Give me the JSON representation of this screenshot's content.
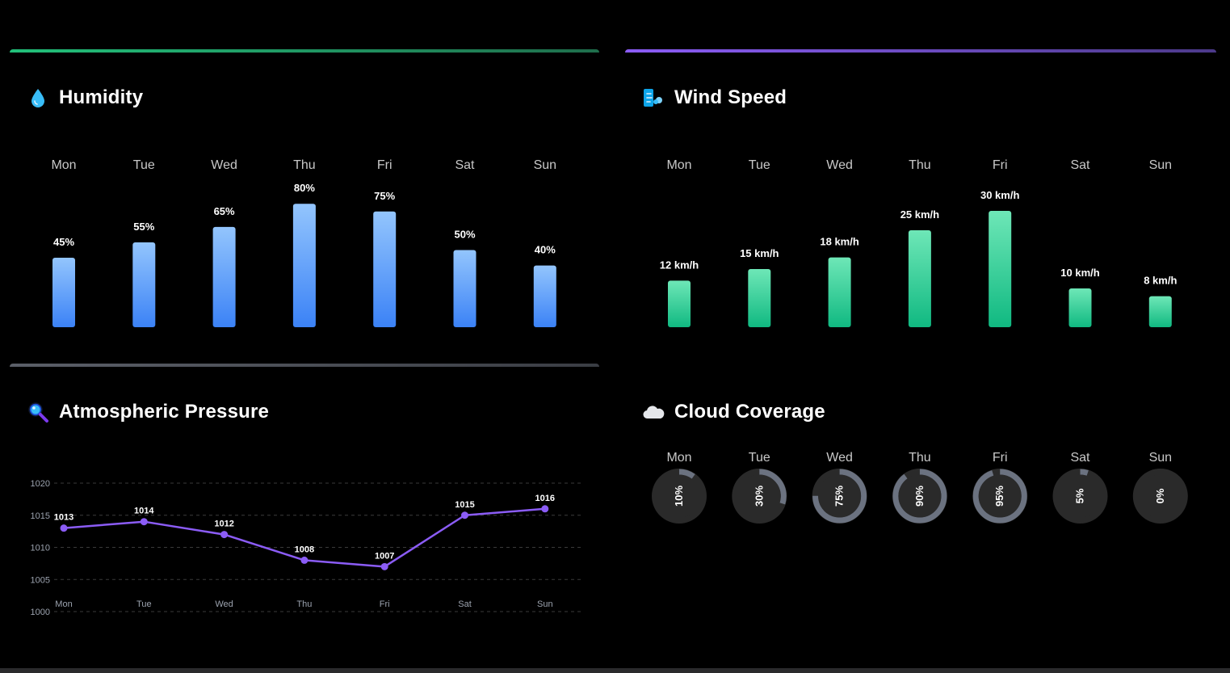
{
  "colors": {
    "humidity_accent": "#22c07a",
    "wind_accent": "#8b5cf6",
    "pressure_accent": "#6b7280",
    "humidity_bar_top": "#93c5fd",
    "humidity_bar_bottom": "#3b82f6",
    "wind_bar_top": "#6ee7b7",
    "wind_bar_bottom": "#10b981",
    "pressure_line": "#8b5cf6",
    "cloud_ring": "#6b7280",
    "cloud_track": "#2a2a2a"
  },
  "cards": {
    "humidity": {
      "title": "Humidity",
      "icon": "droplet-icon"
    },
    "wind": {
      "title": "Wind Speed",
      "icon": "wind-icon"
    },
    "pressure": {
      "title": "Atmospheric Pressure",
      "icon": "magnifier-icon"
    },
    "cloud": {
      "title": "Cloud Coverage",
      "icon": "cloud-icon"
    }
  },
  "chart_data": [
    {
      "id": "humidity",
      "type": "bar",
      "categories": [
        "Mon",
        "Tue",
        "Wed",
        "Thu",
        "Fri",
        "Sat",
        "Sun"
      ],
      "values": [
        45,
        55,
        65,
        80,
        75,
        50,
        40
      ],
      "labels": [
        "45%",
        "55%",
        "65%",
        "80%",
        "75%",
        "50%",
        "40%"
      ],
      "ylim": [
        0,
        100
      ],
      "title": "Humidity"
    },
    {
      "id": "wind",
      "type": "bar",
      "categories": [
        "Mon",
        "Tue",
        "Wed",
        "Thu",
        "Fri",
        "Sat",
        "Sun"
      ],
      "values": [
        12,
        15,
        18,
        25,
        30,
        10,
        8
      ],
      "labels": [
        "12 km/h",
        "15 km/h",
        "18 km/h",
        "25 km/h",
        "30 km/h",
        "10 km/h",
        "8 km/h"
      ],
      "ylim": [
        0,
        30
      ],
      "title": "Wind Speed"
    },
    {
      "id": "pressure",
      "type": "line",
      "categories": [
        "Mon",
        "Tue",
        "Wed",
        "Thu",
        "Fri",
        "Sat",
        "Sun"
      ],
      "values": [
        1013,
        1014,
        1012,
        1008,
        1007,
        1015,
        1016
      ],
      "yticks": [
        1000,
        1005,
        1010,
        1015,
        1020
      ],
      "ylim": [
        1000,
        1020
      ],
      "grid": true,
      "title": "Atmospheric Pressure"
    },
    {
      "id": "cloud",
      "type": "pie",
      "categories": [
        "Mon",
        "Tue",
        "Wed",
        "Thu",
        "Fri",
        "Sat",
        "Sun"
      ],
      "values": [
        10,
        30,
        75,
        90,
        95,
        5,
        0
      ],
      "labels": [
        "10%",
        "30%",
        "75%",
        "90%",
        "95%",
        "5%",
        "0%"
      ],
      "title": "Cloud Coverage"
    }
  ]
}
